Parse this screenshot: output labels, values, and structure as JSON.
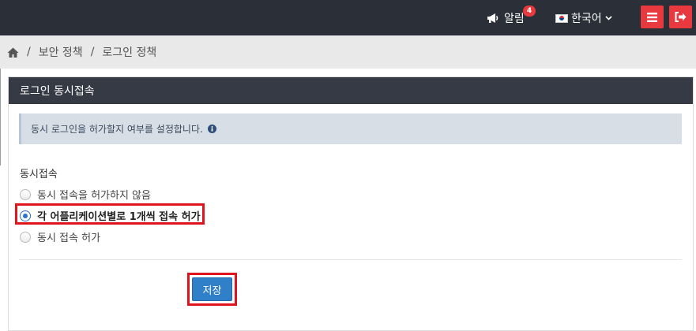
{
  "topbar": {
    "notification_label": "알림",
    "notification_count": "4",
    "language_label": "한국어"
  },
  "breadcrumb": {
    "items": [
      "보안 정책",
      "로그인 정책"
    ]
  },
  "panel": {
    "title": "로그인 동시접속",
    "info_text": "동시 로그인을 허가할지 여부를 설정합니다.",
    "field_label": "동시접속",
    "options": [
      {
        "label": "동시 접속을 허가하지 않음",
        "selected": false
      },
      {
        "label": "각 어플리케이션별로 1개씩 접속 허가",
        "selected": true
      },
      {
        "label": "동시 접속 허가",
        "selected": false
      }
    ],
    "save_label": "저장"
  },
  "colors": {
    "topbar_bg": "#2b2f38",
    "accent_red": "#e8393f",
    "primary_blue": "#2f7fc9",
    "highlight_red": "#e0141c"
  },
  "icons": [
    "megaphone-icon",
    "korea-flag-icon",
    "chevron-down-icon",
    "hamburger-menu-icon",
    "logout-icon",
    "home-icon",
    "info-circle-icon"
  ]
}
